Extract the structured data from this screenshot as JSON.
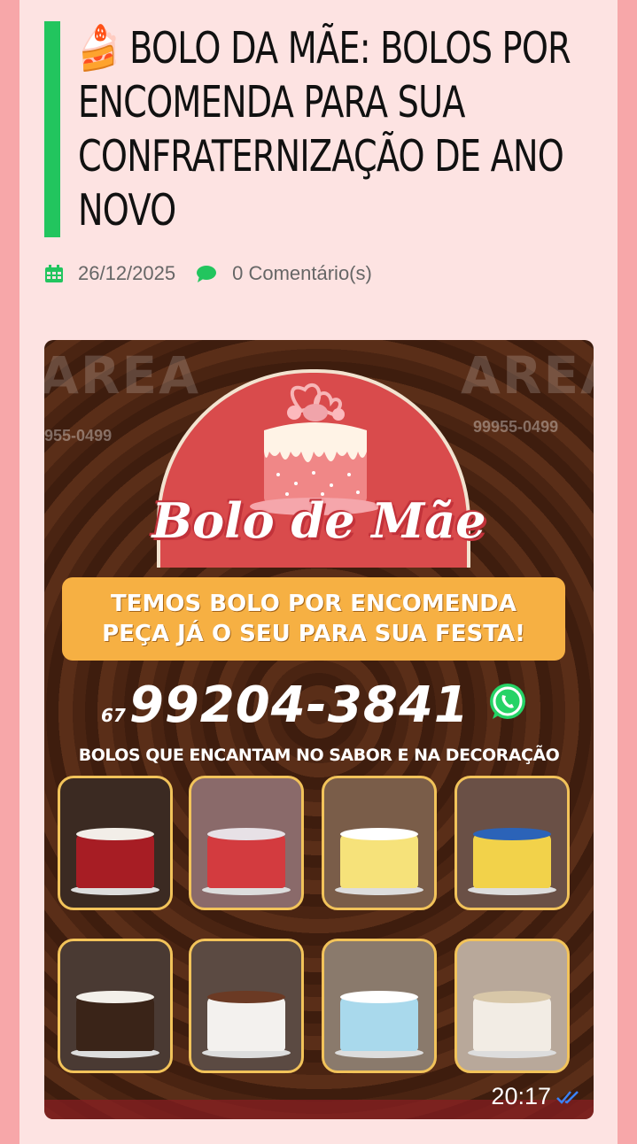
{
  "post": {
    "title": "🍰 BOLO DA MÃE: BOLOS POR ENCOMENDA PARA SUA CONFRATERNIZAÇÃO DE ANO NOVO",
    "date": "26/12/2025",
    "comments": "0 Comentário(s)"
  },
  "poster": {
    "brand": "Bolo de Mãe",
    "banner_line1": "TEMOS BOLO POR ENCOMENDA",
    "banner_line2": "PEÇA JÁ O SEU PARA SUA FESTA!",
    "phone_ddd": "67",
    "phone_number": "99204-3841",
    "tagline": "BOLOS QUE ENCANTAM NO SABOR E NA DECORAÇÃO",
    "watermark": "AREA",
    "watermark_phone": "99955-0499",
    "timestamp": "20:17"
  },
  "colors": {
    "accent": "#22c55e",
    "background": "#fde3e2",
    "page_edge": "#f7a7a9",
    "banner": "#f6b043",
    "arch": "#d94b4c"
  },
  "icons": {
    "date": "calendar-icon",
    "comments": "comment-icon",
    "whatsapp": "whatsapp-icon",
    "read": "double-check-icon"
  }
}
